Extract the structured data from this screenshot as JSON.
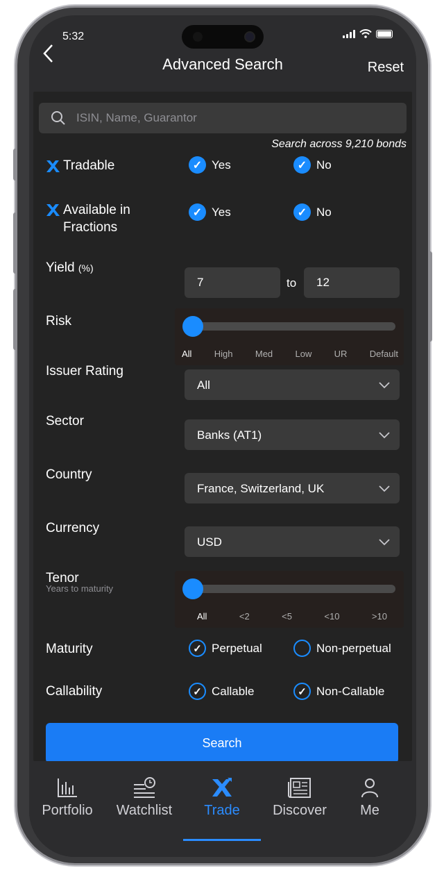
{
  "status": {
    "time": "5:32"
  },
  "header": {
    "title": "Advanced Search",
    "reset": "Reset"
  },
  "search": {
    "placeholder": "ISIN, Name, Guarantor",
    "note": "Search across 9,210 bonds"
  },
  "tradable": {
    "label": "Tradable",
    "yes": "Yes",
    "no": "No",
    "yes_checked": true,
    "no_checked": true
  },
  "fractions": {
    "label_line1": "Available in",
    "label_line2": "Fractions",
    "yes": "Yes",
    "no": "No",
    "yes_checked": true,
    "no_checked": true
  },
  "yield": {
    "label": "Yield",
    "unit": "(%)",
    "from": "7",
    "to_label": "to",
    "to": "12"
  },
  "risk": {
    "label": "Risk",
    "ticks": [
      "All",
      "High",
      "Med",
      "Low",
      "UR",
      "Default"
    ],
    "selected": "All"
  },
  "issuer_rating": {
    "label": "Issuer Rating",
    "value": "All"
  },
  "sector": {
    "label": "Sector",
    "value": "Banks (AT1)"
  },
  "country": {
    "label": "Country",
    "value": "France, Switzerland, UK"
  },
  "currency": {
    "label": "Currency",
    "value": "USD"
  },
  "tenor": {
    "label": "Tenor",
    "sublabel": "Years to maturity",
    "ticks": [
      "All",
      "<2",
      "<5",
      "<10",
      ">10"
    ],
    "selected": "All"
  },
  "maturity": {
    "label": "Maturity",
    "opt1": "Perpetual",
    "opt2": "Non-perpetual",
    "opt1_checked": true,
    "opt2_checked": false
  },
  "callability": {
    "label": "Callability",
    "opt1": "Callable",
    "opt2": "Non-Callable",
    "opt1_checked": true,
    "opt2_checked": true
  },
  "search_button": "Search",
  "tabs": [
    {
      "label": "Portfolio",
      "icon": "bar-chart-icon"
    },
    {
      "label": "Watchlist",
      "icon": "watchlist-icon"
    },
    {
      "label": "Trade",
      "icon": "trade-logo-icon",
      "active": true
    },
    {
      "label": "Discover",
      "icon": "newspaper-icon"
    },
    {
      "label": "Me",
      "icon": "person-icon"
    }
  ],
  "colors": {
    "accent": "#1a8cff",
    "background": "#232323",
    "field": "#3a3a3a"
  }
}
